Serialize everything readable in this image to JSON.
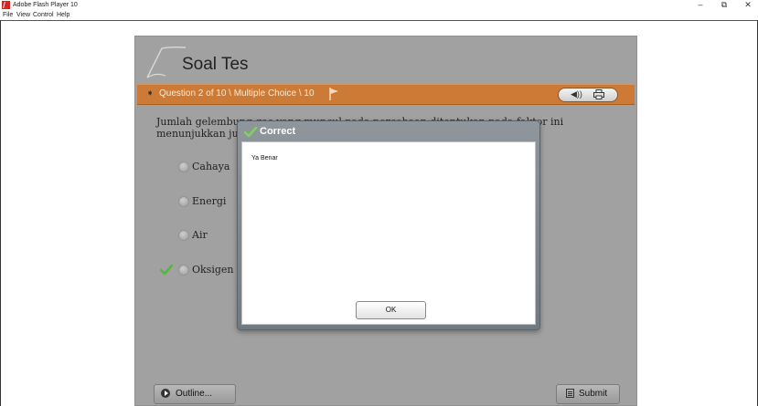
{
  "window": {
    "title": "Adobe Flash Player 10",
    "controls": {
      "minimize": "–",
      "restore": "⧉",
      "close": "✕"
    }
  },
  "menu": [
    "File",
    "View",
    "Control",
    "Help"
  ],
  "quiz": {
    "title": "Soal Tes",
    "question_info": "Question 2 of 10 \\ Multiple Choice \\ 10",
    "question_text": "Jumlah gelembung gas yang muncul pada percobaan ditentukan pada faktor ini menunjukkan jumlah .... yang dihasilkan",
    "options": [
      "Cahaya",
      "Energi",
      "Air",
      "Oksigen"
    ],
    "outline_label": "Outline...",
    "submit_label": "Submit"
  },
  "dialog": {
    "title": "Correct",
    "message": "Ya Benar",
    "ok_label": "OK"
  },
  "colors": {
    "stage": "#a1a1a1",
    "question_bar": "#cc7a35",
    "correct_check": "#55b83a"
  }
}
